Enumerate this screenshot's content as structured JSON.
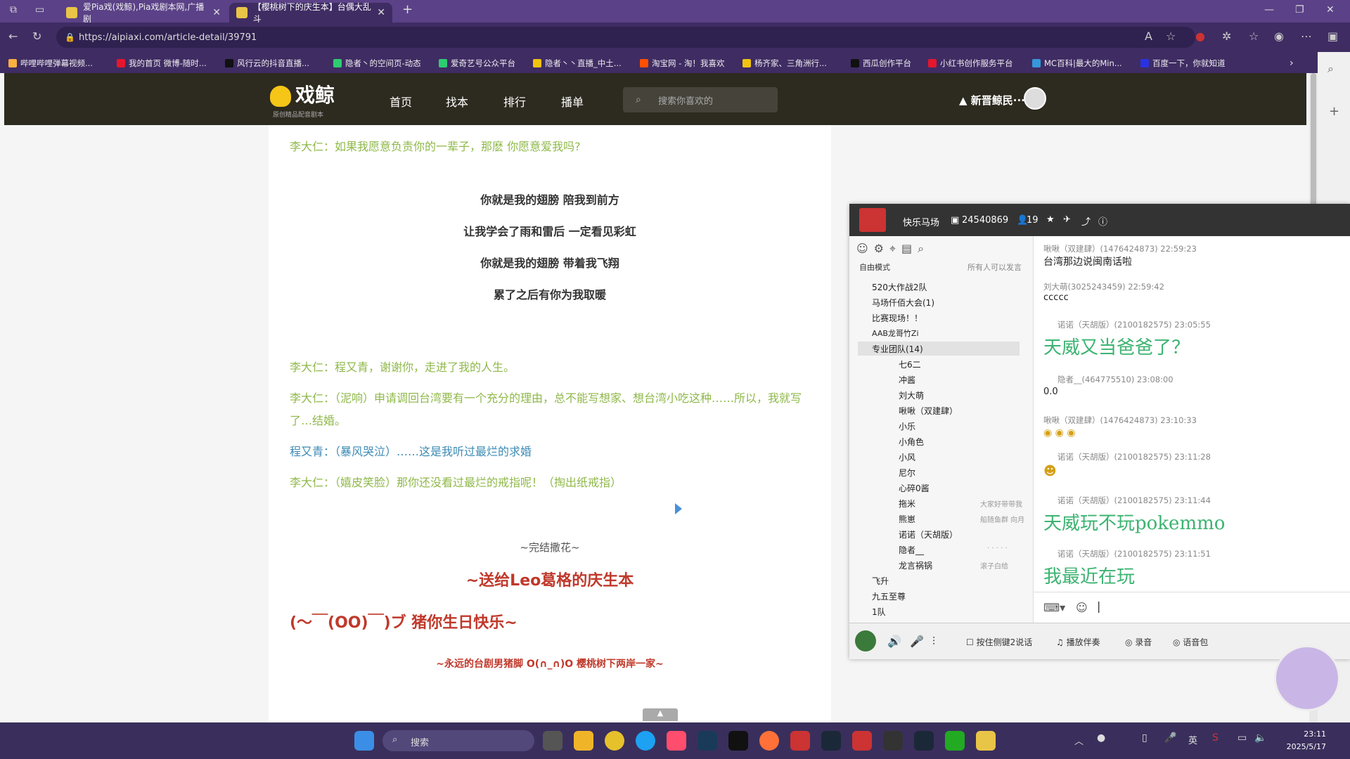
{
  "browser": {
    "tabs": [
      {
        "label": "爱Pia戏(戏鲸),Pia戏剧本网,广播剧",
        "active": false
      },
      {
        "label": "【樱桃树下的庆生本】台偶大乱斗",
        "active": true
      }
    ],
    "url": "https://aipiaxi.com/article-detail/39791",
    "bookmarks": [
      "哔哩哔哩弹幕视频...",
      "我的首页 微博-随时...",
      "风行云的抖音直播...",
      "隐者丶的空间页-动态",
      "爱奇艺号公众平台",
      "隐者丶丶直播_中土...",
      "淘宝网 - 淘！我喜欢",
      "杨齐家、三角洲行...",
      "西瓜创作平台",
      "小红书创作服务平台",
      "MC百科|最大的Min...",
      "百度一下，你就知道"
    ]
  },
  "site": {
    "logo": "戏鲸",
    "logo_sub": "原创精品配音剧本",
    "nav": [
      "首页",
      "找本",
      "排行",
      "播单"
    ],
    "search_placeholder": "搜索你喜欢的",
    "username": "新晋鲸民···"
  },
  "article": {
    "lines": [
      {
        "text": "李大仁：如果我愿意负责你的一辈子，那麽 你愿意爱我吗?",
        "style": "g"
      },
      {
        "text": "你就是我的翅膀 陪我到前方",
        "style": "k"
      },
      {
        "text": "让我学会了雨和雷后 一定看见彩虹",
        "style": "k"
      },
      {
        "text": "你就是我的翅膀 带着我飞翔",
        "style": "k"
      },
      {
        "text": "累了之后有你为我取暖",
        "style": "k"
      },
      {
        "text": "李大仁：程又青，谢谢你，走进了我的人生。",
        "style": "g"
      },
      {
        "text": "李大仁：（泥响）申请调回台湾要有一个充分的理由，总不能写想家、想台湾小吃这种……所以，我就写",
        "style": "g"
      },
      {
        "text": "了…结婚。",
        "style": "g"
      },
      {
        "text": "程又青：（暴风哭泣）……这是我听过最烂的求婚",
        "style": "b"
      },
      {
        "text": "李大仁：（嬉皮笑脸）那你还没看过最烂的戒指呢！（掏出纸戒指）",
        "style": "g"
      },
      {
        "text": "~完结撒花~",
        "style": "c"
      },
      {
        "text": "~送给Leo葛格的庆生本",
        "style": "red-big"
      },
      {
        "text": "(～￣(OO)￣)ブ 猪你生日快乐~",
        "style": "red-mid"
      },
      {
        "text": "~永远的台剧男猪脚 O(∩_∩)O 樱桃树下两岸一家~",
        "style": "red-small"
      }
    ]
  },
  "chat_panel": {
    "title": "快乐马场",
    "room_id": "24540869",
    "online": "19",
    "mode": "自由模式",
    "mode_note": "所有人可以发言",
    "tree": [
      "520大作战2队",
      "马场仟佰大会(1)",
      "比赛现场！！",
      "AAB龙哥竹Zi",
      "专业团队(14)",
      "七6二",
      "冲酱",
      "刘大萌",
      "啾啾（双建肆）",
      "小乐",
      "小角色",
      "小风",
      "尼尔",
      "心碎0酱",
      "拖米",
      "熊崽",
      "诺诺（天胡版）",
      "隐者__",
      "龙言祸锅",
      "飞升",
      "九五至尊",
      "1队"
    ],
    "tree_notes": {
      "拖米": "大家好带带我",
      "熊崽": "船随鱼群 向月",
      "隐者__": "· · · · ·",
      "龙言祸锅": "滚子白给"
    },
    "messages": [
      {
        "hdr": "啾啾（双建肆）(1476424873) 22:59:23",
        "text": "台湾那边说闽南话啦",
        "big": false
      },
      {
        "hdr": "刘大萌(3025243459) 22:59:42",
        "text": "ccccc",
        "big": false
      },
      {
        "hdr": "诺诺（天胡版）(2100182575) 23:05:55",
        "text": "天威又当爸爸了？",
        "big": true
      },
      {
        "hdr": "隐者__(464775510) 23:08:00",
        "text": "0.0",
        "big": false
      },
      {
        "hdr": "啾啾（双建肆）(1476424873) 23:10:33",
        "text": "",
        "big": false
      },
      {
        "hdr": "诺诺（天胡版）(2100182575) 23:11:28",
        "text": "",
        "big": false
      },
      {
        "hdr": "诺诺（天胡版）(2100182575) 23:11:44",
        "text": "天威玩不玩pokemmo",
        "big": true
      },
      {
        "hdr": "诺诺（天胡版）(2100182575) 23:11:51",
        "text": "我最近在玩",
        "big": true
      }
    ],
    "bottom": [
      "按住侧键2说话",
      "播放伴奏",
      "录音",
      "语音包"
    ]
  },
  "taskbar": {
    "search": "搜索",
    "time": "23:11",
    "date": "2025/5/17",
    "lang": "英"
  },
  "colors": {
    "accent_green": "#3cb371",
    "line_green": "#8fb84a",
    "line_blue": "#3c8ab4",
    "red": "#c0392b"
  }
}
